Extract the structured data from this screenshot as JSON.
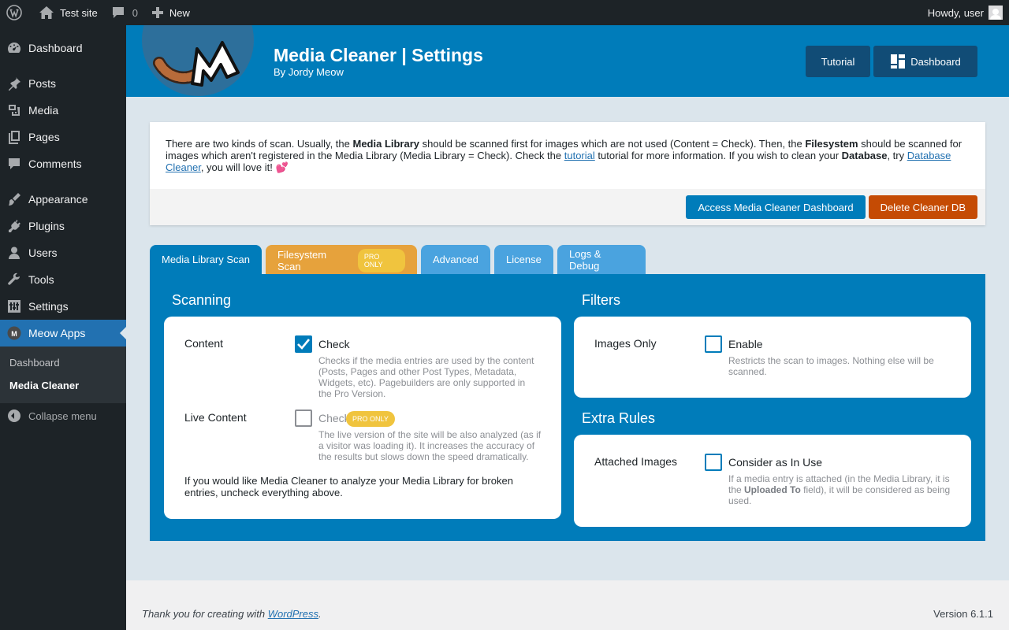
{
  "adminbar": {
    "site_name": "Test site",
    "comments_count": "0",
    "new_label": "New",
    "howdy": "Howdy, user"
  },
  "sidebar": {
    "items": [
      {
        "label": "Dashboard",
        "icon": "dashboard-icon"
      },
      {
        "label": "Posts",
        "icon": "pin-icon"
      },
      {
        "label": "Media",
        "icon": "media-icon"
      },
      {
        "label": "Pages",
        "icon": "pages-icon"
      },
      {
        "label": "Comments",
        "icon": "comment-icon"
      },
      {
        "label": "Appearance",
        "icon": "brush-icon"
      },
      {
        "label": "Plugins",
        "icon": "plug-icon"
      },
      {
        "label": "Users",
        "icon": "user-icon"
      },
      {
        "label": "Tools",
        "icon": "wrench-icon"
      },
      {
        "label": "Settings",
        "icon": "settings-icon"
      },
      {
        "label": "Meow Apps",
        "icon": "meow-icon"
      }
    ],
    "submenu": [
      "Dashboard",
      "Media Cleaner"
    ],
    "collapse": "Collapse menu"
  },
  "header": {
    "title": "Media Cleaner | Settings",
    "subtitle": "By Jordy Meow",
    "tutorial_btn": "Tutorial",
    "dashboard_btn": "Dashboard"
  },
  "intro": {
    "t1": "There are two kinds of scan. Usually, the ",
    "b1": "Media Library",
    "t2": " should be scanned first for images which are not used (Content = Check). Then, the ",
    "b2": "Filesystem",
    "t3": " should be scanned for images which aren't registered in the Media Library (Media Library = Check). Check the ",
    "link1": "tutorial",
    "t4": " tutorial for more information. If you wish to clean your ",
    "b3": "Database",
    "t5": ", try ",
    "link2": "Database Cleaner",
    "t6": ", you will love it! 💕",
    "access_btn": "Access Media Cleaner Dashboard",
    "delete_btn": "Delete Cleaner DB"
  },
  "tabs": {
    "t1": "Media Library Scan",
    "t2": "Filesystem Scan",
    "t2_badge": "PRO ONLY",
    "t3": "Advanced",
    "t4": "License",
    "t5": "Logs & Debug"
  },
  "scanning": {
    "title": "Scanning",
    "content_label": "Content",
    "content_cb": "Check",
    "content_desc": "Checks if the media entries are used by the content (Posts, Pages and other Post Types, Metadata, Widgets, etc). Pagebuilders are only supported in the Pro Version.",
    "live_label": "Live Content",
    "live_cb": "Check",
    "live_badge": "PRO ONLY",
    "live_desc": "The live version of the site will be also analyzed (as if a visitor was loading it). It increases the accuracy of the results but slows down the speed dramatically.",
    "note": "If you would like Media Cleaner to analyze your Media Library for broken entries, uncheck everything above."
  },
  "filters": {
    "title": "Filters",
    "images_label": "Images Only",
    "images_cb": "Enable",
    "images_desc": "Restricts the scan to images. Nothing else will be scanned."
  },
  "extra": {
    "title": "Extra Rules",
    "attached_label": "Attached Images",
    "attached_cb": "Consider as In Use",
    "d1": "If a media entry is attached (in the Media Library, it is the ",
    "d2": "Uploaded To",
    "d3": " field), it will be considered as being used."
  },
  "footer": {
    "thanks": "Thank you for creating with ",
    "wp_link": "WordPress",
    "dot": ".",
    "version": "Version 6.1.1"
  },
  "colors": {
    "primary": "#007cba",
    "danger": "#c54b04",
    "pro": "#f0c43e",
    "filesystem_tab": "#e6a23c"
  }
}
